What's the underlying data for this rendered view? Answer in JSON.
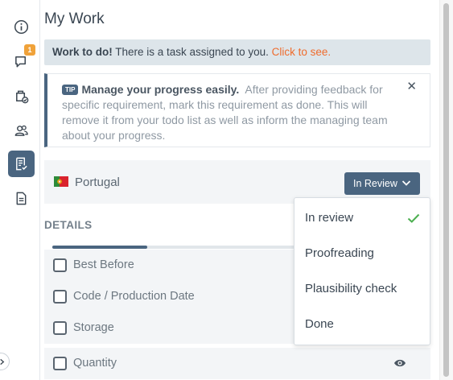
{
  "sidebar": {
    "items": [
      {
        "name": "info-icon",
        "active": false
      },
      {
        "name": "comments-icon",
        "active": false,
        "badge": "1"
      },
      {
        "name": "package-check-icon",
        "active": false
      },
      {
        "name": "users-icon",
        "active": false
      },
      {
        "name": "checklist-icon",
        "active": true
      },
      {
        "name": "document-icon",
        "active": false
      }
    ],
    "toggle_icon": "chevron-right-icon"
  },
  "page": {
    "title": "My Work"
  },
  "notice": {
    "strong": "Work to do!",
    "text": " There is a task assigned to you. ",
    "link": "Click to see."
  },
  "tip": {
    "badge": "TIP",
    "heading": "Manage your progress easily.",
    "body": "After providing feedback for specific requirement, mark this requirement as done. This will remove it from your todo list as well as inform the managing team about your progress.",
    "close": "✕"
  },
  "country": {
    "name": "Portugal",
    "flag_icon": "portugal-flag-icon",
    "status": "In Review"
  },
  "details": {
    "label": "DETAILS",
    "progress": 0.25,
    "rows": [
      {
        "label": "Best Before"
      },
      {
        "label": "Code / Production Date"
      },
      {
        "label": "Storage"
      },
      {
        "label": "Quantity",
        "icon": "eye-icon"
      }
    ]
  },
  "status_menu": {
    "options": [
      {
        "label": "In review",
        "selected": true
      },
      {
        "label": "Proofreading",
        "selected": false
      },
      {
        "label": "Plausibility check",
        "selected": false
      },
      {
        "label": "Done",
        "selected": false
      }
    ]
  },
  "colors": {
    "accent": "#4a6580",
    "link": "#ef6c2d",
    "badge": "#f0a23a",
    "check": "#4caf50"
  }
}
